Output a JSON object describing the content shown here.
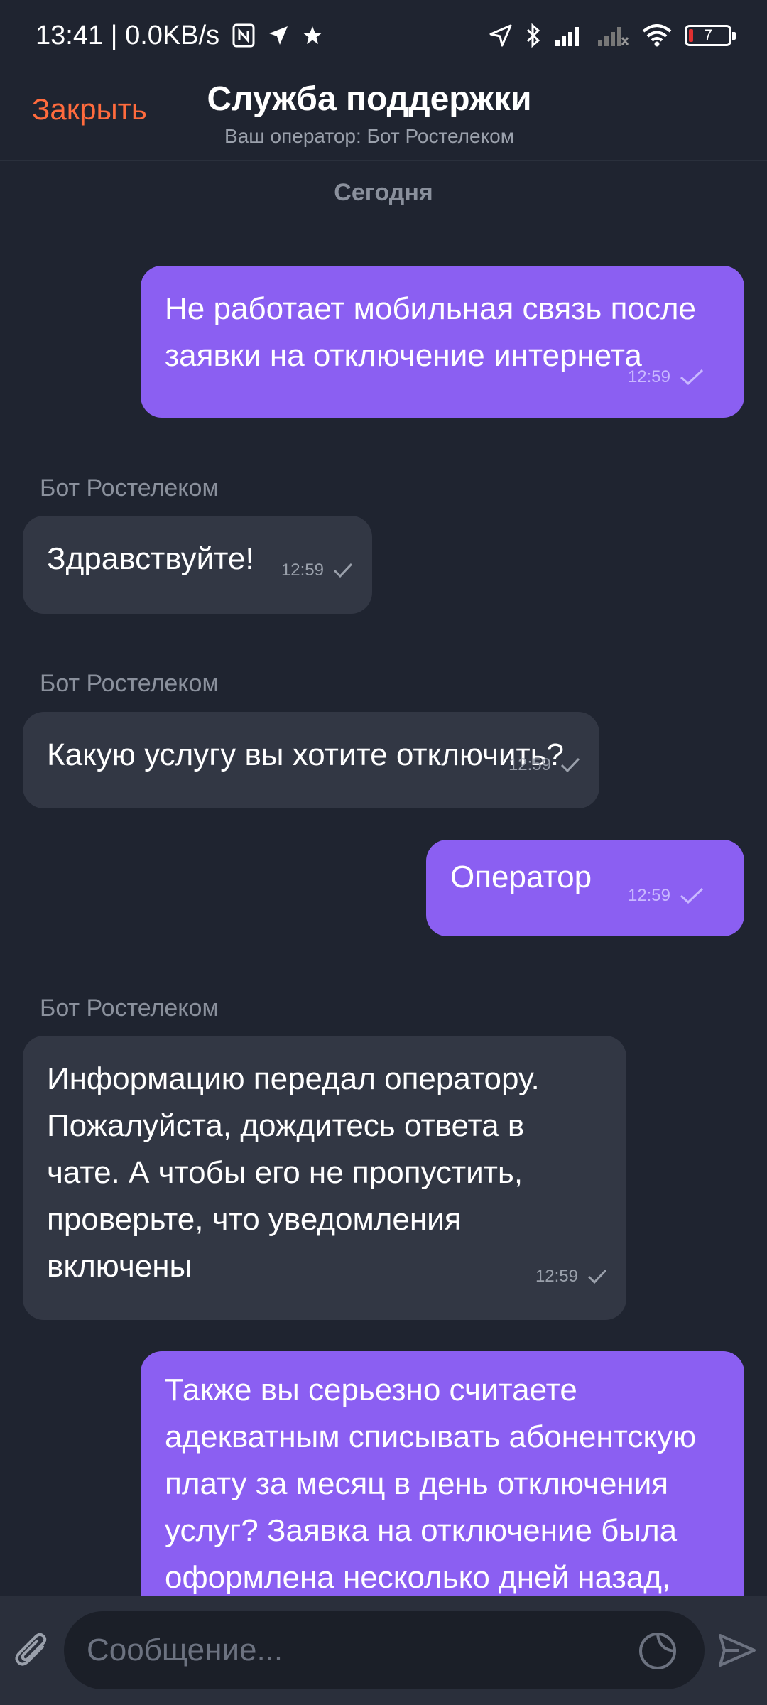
{
  "status_bar": {
    "time_speed": "13:41 | 0.0KB/s",
    "battery_level": "7",
    "icons": [
      "nfc-icon",
      "location-arrow-icon",
      "star-icon",
      "navigation-icon",
      "bluetooth-icon",
      "signal-icon",
      "signal-2-icon",
      "wifi-icon",
      "battery-icon"
    ]
  },
  "header": {
    "close_label": "Закрыть",
    "title": "Служба поддержки",
    "subtitle": "Ваш оператор: Бот Ростелеком",
    "accent_color": "#ff6b3d"
  },
  "date_divider": "Сегодня",
  "messages": [
    {
      "direction": "out",
      "text": "Не работает мобильная связь после\nзаявки на отключение интернета",
      "time": "12:59"
    },
    {
      "direction": "in",
      "sender": "Бот Ростелеком",
      "text": "Здравствуйте!",
      "time": "12:59"
    },
    {
      "direction": "in",
      "sender": "Бот Ростелеком",
      "text": "Какую услугу вы хотите отключить?",
      "time": "12:59"
    },
    {
      "direction": "out",
      "text": "Оператор",
      "time": "12:59"
    },
    {
      "direction": "in",
      "sender": "Бот Ростелеком",
      "text": "Информацию передал оператору.\nПожалуйста, дождитесь ответа в\nчате. А чтобы его не пропустить,\nпроверьте, что уведомления\nвключены",
      "time": "12:59"
    },
    {
      "direction": "out",
      "text": "Также вы серьезно считаете\nадекватным списывать абонентскую\nплату за месяц в день отключения\nуслуг? Заявка на отключение была\nоформлена несколько дней назад,"
    }
  ],
  "composer": {
    "placeholder": "Сообщение...",
    "value": ""
  },
  "colors": {
    "background": "#1f2430",
    "outgoing_bubble": "#8b5ff2",
    "incoming_bubble": "#323744"
  }
}
